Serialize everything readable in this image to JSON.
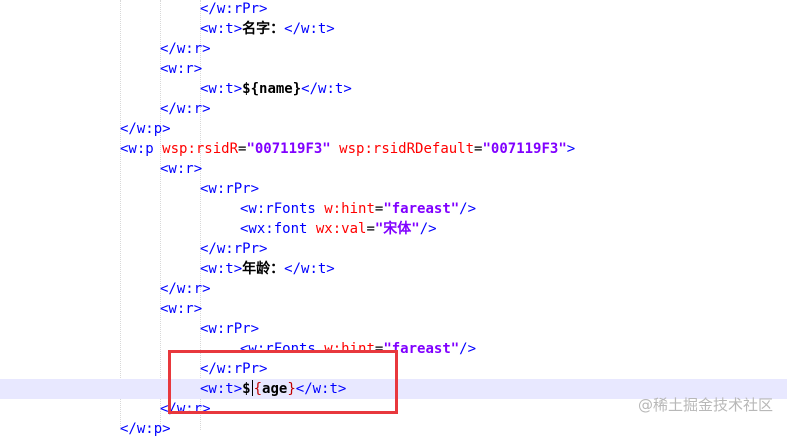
{
  "code_lines": [
    {
      "indent": 5,
      "segments": [
        {
          "t": "</w:rPr>",
          "c": "tag"
        }
      ]
    },
    {
      "indent": 5,
      "segments": [
        {
          "t": "<w:t>",
          "c": "tag"
        },
        {
          "t": "名字：",
          "c": "txt"
        },
        {
          "t": "</w:t>",
          "c": "tag"
        }
      ]
    },
    {
      "indent": 4,
      "segments": [
        {
          "t": "</w:r>",
          "c": "tag"
        }
      ]
    },
    {
      "indent": 4,
      "segments": [
        {
          "t": "<w:r>",
          "c": "tag"
        }
      ]
    },
    {
      "indent": 5,
      "segments": [
        {
          "t": "<w:t>",
          "c": "tag"
        },
        {
          "t": "${name}",
          "c": "txt"
        },
        {
          "t": "</w:t>",
          "c": "tag"
        }
      ]
    },
    {
      "indent": 4,
      "segments": [
        {
          "t": "</w:r>",
          "c": "tag"
        }
      ]
    },
    {
      "indent": 3,
      "segments": [
        {
          "t": "</w:p>",
          "c": "tag"
        }
      ]
    },
    {
      "indent": 3,
      "segments": [
        {
          "t": "<w:p ",
          "c": "tag"
        },
        {
          "t": "wsp:rsidR",
          "c": "attr"
        },
        {
          "t": "=",
          "c": "eq"
        },
        {
          "t": "\"007119F3\"",
          "c": "val"
        },
        {
          "t": " wsp:rsidRDefault",
          "c": "attr"
        },
        {
          "t": "=",
          "c": "eq"
        },
        {
          "t": "\"007119F3\"",
          "c": "val"
        },
        {
          "t": ">",
          "c": "tag"
        }
      ]
    },
    {
      "indent": 4,
      "segments": [
        {
          "t": "<w:r>",
          "c": "tag"
        }
      ]
    },
    {
      "indent": 5,
      "segments": [
        {
          "t": "<w:rPr>",
          "c": "tag"
        }
      ]
    },
    {
      "indent": 6,
      "segments": [
        {
          "t": "<w:rFonts ",
          "c": "tag"
        },
        {
          "t": "w:hint",
          "c": "attr"
        },
        {
          "t": "=",
          "c": "eq"
        },
        {
          "t": "\"fareast\"",
          "c": "val"
        },
        {
          "t": "/>",
          "c": "tag"
        }
      ]
    },
    {
      "indent": 6,
      "segments": [
        {
          "t": "<wx:font ",
          "c": "tag"
        },
        {
          "t": "wx:val",
          "c": "attr"
        },
        {
          "t": "=",
          "c": "eq"
        },
        {
          "t": "\"宋体\"",
          "c": "val"
        },
        {
          "t": "/>",
          "c": "tag"
        }
      ]
    },
    {
      "indent": 5,
      "segments": [
        {
          "t": "</w:rPr>",
          "c": "tag"
        }
      ]
    },
    {
      "indent": 5,
      "segments": [
        {
          "t": "<w:t>",
          "c": "tag"
        },
        {
          "t": "年龄：",
          "c": "txt"
        },
        {
          "t": "</w:t>",
          "c": "tag"
        }
      ]
    },
    {
      "indent": 4,
      "segments": [
        {
          "t": "</w:r>",
          "c": "tag"
        }
      ]
    },
    {
      "indent": 4,
      "segments": [
        {
          "t": "<w:r>",
          "c": "tag"
        }
      ]
    },
    {
      "indent": 5,
      "segments": [
        {
          "t": "<w:rPr>",
          "c": "tag"
        }
      ]
    },
    {
      "indent": 6,
      "segments": [
        {
          "t": "<w:rFonts ",
          "c": "tag"
        },
        {
          "t": "w:hint",
          "c": "attr"
        },
        {
          "t": "=",
          "c": "eq"
        },
        {
          "t": "\"fareast\"",
          "c": "val"
        },
        {
          "t": "/>",
          "c": "tag"
        }
      ]
    },
    {
      "indent": 5,
      "segments": [
        {
          "t": "</w:rPr>",
          "c": "tag"
        }
      ]
    },
    {
      "indent": 5,
      "current": true,
      "segments": [
        {
          "t": "<w:t>",
          "c": "tag"
        },
        {
          "t": "$",
          "c": "dol"
        },
        {
          "t": "|",
          "c": "caret"
        },
        {
          "t": "{",
          "c": "brace"
        },
        {
          "t": "age",
          "c": "txt"
        },
        {
          "t": "}",
          "c": "brace"
        },
        {
          "t": "</w:t>",
          "c": "tag"
        }
      ]
    },
    {
      "indent": 4,
      "segments": [
        {
          "t": "</w:r>",
          "c": "tag"
        }
      ]
    },
    {
      "indent": 3,
      "segments": [
        {
          "t": "</w:p>",
          "c": "tag"
        }
      ]
    }
  ],
  "watermark": "@稀土掘金技术社区",
  "colors": {
    "tag": "#0000ff",
    "attr": "#ff0000",
    "value": "#8000ff",
    "highlight_box": "#e8383d",
    "current_line": "#e8e8ff"
  }
}
